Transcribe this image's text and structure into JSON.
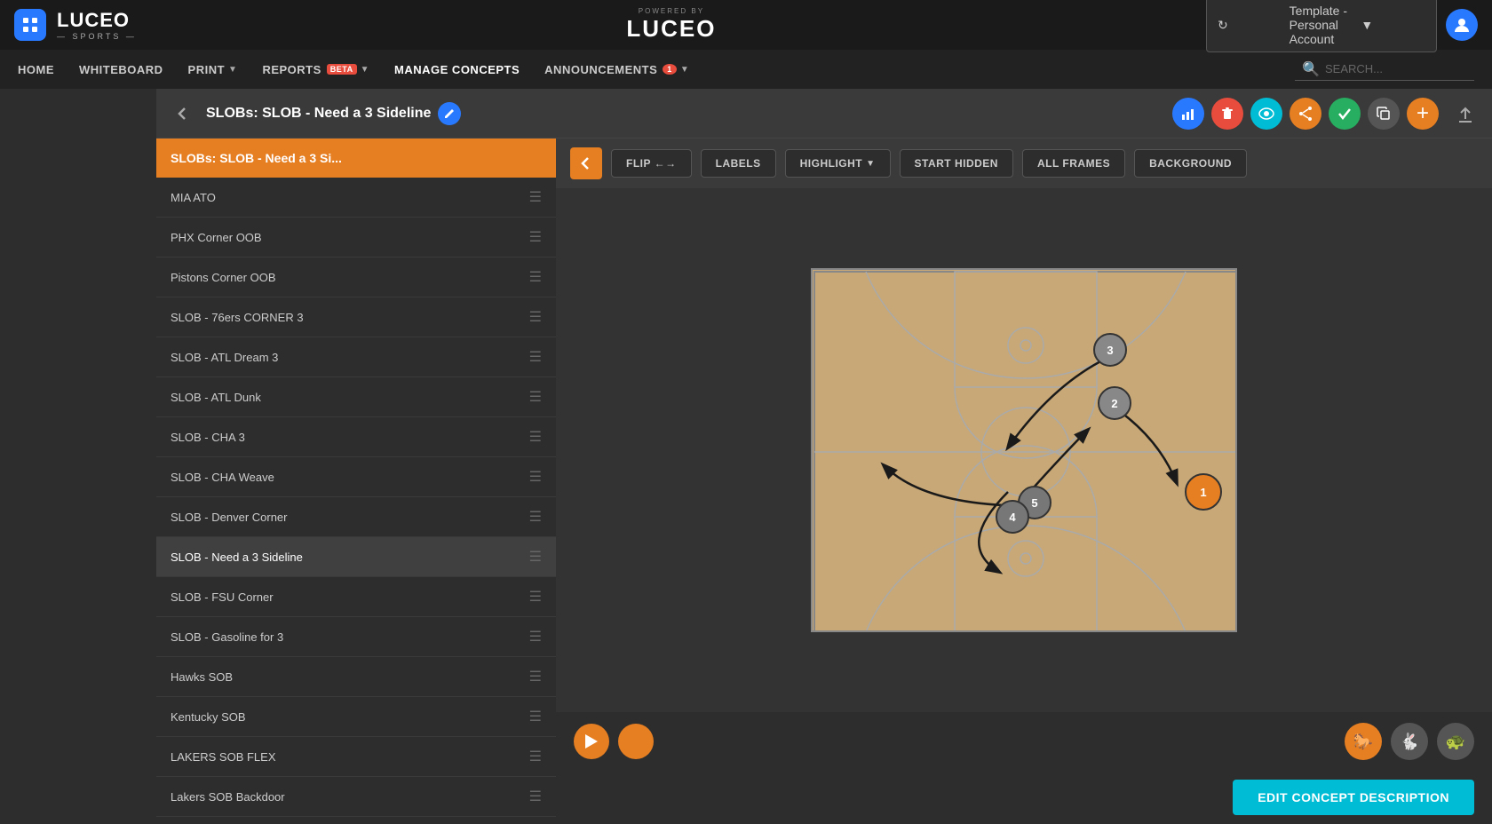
{
  "app": {
    "name": "LUCEO",
    "sub": "— SPORTS —",
    "powered_by": "POWERED BY"
  },
  "account": {
    "label": "Template - Personal Account"
  },
  "nav": {
    "items": [
      {
        "id": "home",
        "label": "HOME"
      },
      {
        "id": "whiteboard",
        "label": "WHITEBOARD"
      },
      {
        "id": "print",
        "label": "PRINT"
      },
      {
        "id": "reports",
        "label": "REPORTS",
        "badge": "BETA"
      },
      {
        "id": "manage-concepts",
        "label": "MANAGE CONCEPTS"
      },
      {
        "id": "announcements",
        "label": "ANNOUNCEMENTS",
        "badge": "1"
      }
    ],
    "search_placeholder": "SEARCH..."
  },
  "header": {
    "title": "SLOBs: SLOB - Need a 3 Sideline",
    "back_label": "←"
  },
  "playlist_header": "SLOBs: SLOB - Need a 3 Si...",
  "playlist_items": [
    {
      "id": "mia-ato",
      "label": "MIA ATO",
      "active": false
    },
    {
      "id": "phx-corner-oob",
      "label": "PHX Corner OOB",
      "active": false
    },
    {
      "id": "pistons-corner-oob",
      "label": "Pistons Corner OOB",
      "active": false
    },
    {
      "id": "slob-76ers-corner-3",
      "label": "SLOB - 76ers CORNER 3",
      "active": false
    },
    {
      "id": "slob-atl-dream-3",
      "label": "SLOB - ATL Dream 3",
      "active": false
    },
    {
      "id": "slob-atl-dunk",
      "label": "SLOB - ATL Dunk",
      "active": false
    },
    {
      "id": "slob-cha-3",
      "label": "SLOB - CHA 3",
      "active": false
    },
    {
      "id": "slob-cha-weave",
      "label": "SLOB - CHA Weave",
      "active": false
    },
    {
      "id": "slob-denver-corner",
      "label": "SLOB - Denver Corner",
      "active": false
    },
    {
      "id": "slob-need-a-3-sideline",
      "label": "SLOB - Need a 3 Sideline",
      "active": true
    },
    {
      "id": "slob-fsu-corner",
      "label": "SLOB - FSU Corner",
      "active": false
    },
    {
      "id": "slob-gasoline-for-3",
      "label": "SLOB - Gasoline for 3",
      "active": false
    },
    {
      "id": "hawks-sob",
      "label": "Hawks SOB",
      "active": false
    },
    {
      "id": "kentucky-sob",
      "label": "Kentucky SOB",
      "active": false
    },
    {
      "id": "lakers-sob-flex",
      "label": "LAKERS SOB FLEX",
      "active": false
    },
    {
      "id": "lakers-sob-backdoor",
      "label": "Lakers SOB Backdoor",
      "active": false
    }
  ],
  "toolbar": {
    "flip_label": "FLIP ←→",
    "labels_label": "LABELS",
    "highlight_label": "HIGHLIGHT",
    "start_hidden_label": "START HIDDEN",
    "all_frames_label": "ALL FRAMES",
    "background_label": "BACKGROUND"
  },
  "actions": {
    "edit_concept_description": "EDIT CONCEPT DESCRIPTION"
  },
  "players": [
    {
      "id": 1,
      "label": "1",
      "x": "right:16px",
      "y": "bottom:100px",
      "color": "#e67e22"
    },
    {
      "id": 2,
      "label": "2",
      "x": "right:110px",
      "y": "top:110px",
      "color": "#555"
    },
    {
      "id": 3,
      "label": "3",
      "x": "right:130px",
      "y": "top:60px",
      "color": "#555"
    },
    {
      "id": 4,
      "label": "4",
      "x": "left:180px",
      "y": "bottom:145px",
      "color": "#555"
    },
    {
      "id": 5,
      "label": "5",
      "x": "left:200px",
      "y": "bottom:118px",
      "color": "#555"
    }
  ]
}
